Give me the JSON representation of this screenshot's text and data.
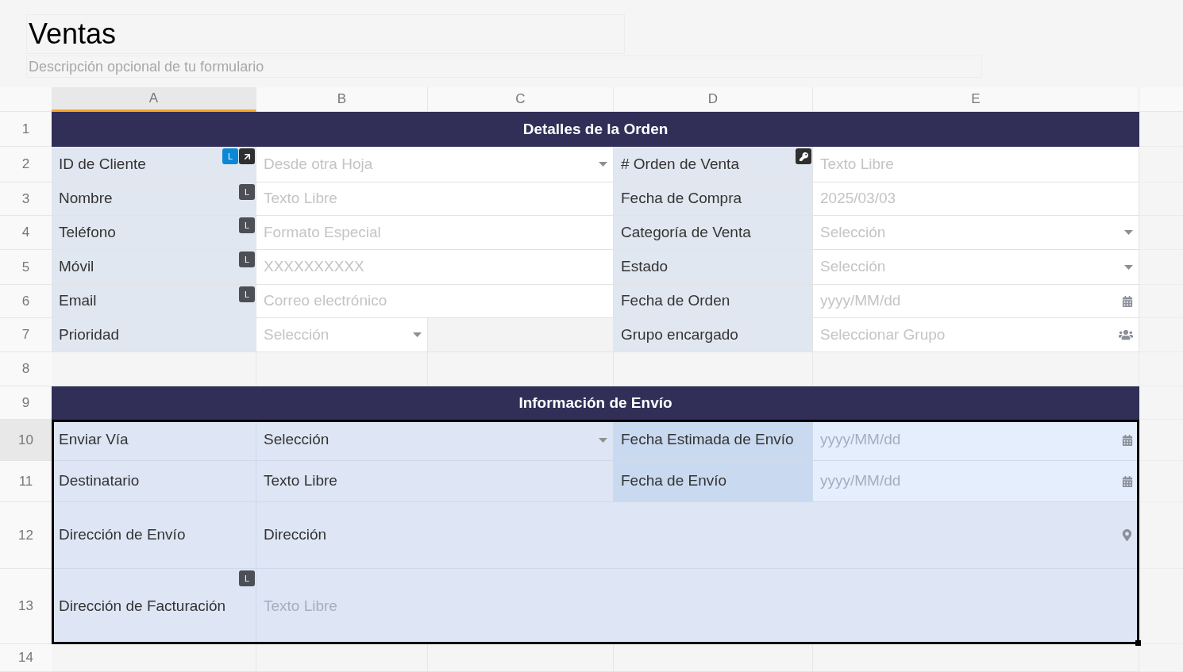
{
  "form": {
    "title": "Ventas",
    "description": "Descripción opcional de tu formulario"
  },
  "columns": [
    {
      "label": "A",
      "selected": true
    },
    {
      "label": "B",
      "selected": false
    },
    {
      "label": "C",
      "selected": false
    },
    {
      "label": "D",
      "selected": false
    },
    {
      "label": "E",
      "selected": false
    }
  ],
  "rows": [
    {
      "number": "1",
      "selected": false,
      "kind": "header",
      "title": "Detalles de la Orden"
    },
    {
      "number": "2",
      "selected": false,
      "kind": "pair",
      "cells": [
        {
          "kind": "label",
          "text": "ID de Cliente",
          "badges": [
            {
              "kind": "letter",
              "text": "L",
              "highlighted": true
            },
            {
              "kind": "link"
            }
          ]
        },
        {
          "kind": "dropdown",
          "placeholder": "Desde otra Hoja"
        },
        {
          "kind": "label",
          "text": "# Orden de Venta",
          "badges": [
            {
              "kind": "key"
            }
          ]
        },
        {
          "kind": "text",
          "placeholder": "Texto Libre"
        }
      ]
    },
    {
      "number": "3",
      "selected": false,
      "kind": "pair",
      "cells": [
        {
          "kind": "label",
          "text": "Nombre",
          "badges": [
            {
              "kind": "letter",
              "text": "L",
              "highlighted": false
            }
          ]
        },
        {
          "kind": "text",
          "placeholder": "Texto Libre"
        },
        {
          "kind": "label",
          "text": "Fecha de Compra"
        },
        {
          "kind": "text",
          "placeholder": "2025/03/03"
        }
      ]
    },
    {
      "number": "4",
      "selected": false,
      "kind": "pair",
      "cells": [
        {
          "kind": "label",
          "text": "Teléfono",
          "badges": [
            {
              "kind": "letter",
              "text": "L",
              "highlighted": false
            }
          ]
        },
        {
          "kind": "text",
          "placeholder": "Formato Especial"
        },
        {
          "kind": "label",
          "text": "Categoría de Venta"
        },
        {
          "kind": "dropdown",
          "placeholder": "Selección"
        }
      ]
    },
    {
      "number": "5",
      "selected": false,
      "kind": "pair",
      "cells": [
        {
          "kind": "label",
          "text": "Móvil",
          "badges": [
            {
              "kind": "letter",
              "text": "L",
              "highlighted": false
            }
          ]
        },
        {
          "kind": "text",
          "placeholder": "XXXXXXXXXX"
        },
        {
          "kind": "label",
          "text": "Estado"
        },
        {
          "kind": "dropdown",
          "placeholder": "Selección"
        }
      ]
    },
    {
      "number": "6",
      "selected": false,
      "kind": "pair",
      "cells": [
        {
          "kind": "label",
          "text": "Email",
          "badges": [
            {
              "kind": "letter",
              "text": "L",
              "highlighted": false
            }
          ]
        },
        {
          "kind": "text",
          "placeholder": "Correo electrónico"
        },
        {
          "kind": "label",
          "text": "Fecha de Orden"
        },
        {
          "kind": "date",
          "placeholder": "yyyy/MM/dd"
        }
      ]
    },
    {
      "number": "7",
      "selected": false,
      "kind": "pair_narrow",
      "cells": [
        {
          "kind": "label",
          "text": "Prioridad"
        },
        {
          "kind": "dropdown",
          "placeholder": "Selección"
        },
        {
          "kind": "empty"
        },
        {
          "kind": "label",
          "text": "Grupo encargado"
        },
        {
          "kind": "group",
          "placeholder": "Seleccionar Grupo"
        }
      ]
    },
    {
      "number": "8",
      "selected": false,
      "kind": "blank"
    },
    {
      "number": "9",
      "selected": false,
      "kind": "header",
      "title": "Información de Envío"
    },
    {
      "number": "10",
      "selected": true,
      "in_selection": true,
      "kind": "pair",
      "cells": [
        {
          "kind": "label",
          "text": "Enviar Vía"
        },
        {
          "kind": "dropdown",
          "value": "Selección"
        },
        {
          "kind": "label",
          "text": "Fecha Estimada de Envío"
        },
        {
          "kind": "date",
          "placeholder": "yyyy/MM/dd"
        }
      ]
    },
    {
      "number": "11",
      "selected": false,
      "in_selection": true,
      "kind": "pair",
      "cells": [
        {
          "kind": "label",
          "text": "Destinatario"
        },
        {
          "kind": "text",
          "value": "Texto Libre"
        },
        {
          "kind": "label",
          "text": "Fecha de Envío"
        },
        {
          "kind": "date",
          "placeholder": "yyyy/MM/dd"
        }
      ]
    },
    {
      "number": "12",
      "selected": false,
      "in_selection": true,
      "kind": "wide",
      "cells": [
        {
          "kind": "label",
          "text": "Dirección de Envío"
        },
        {
          "kind": "address",
          "value": "Dirección"
        }
      ]
    },
    {
      "number": "13",
      "selected": false,
      "in_selection": true,
      "kind": "wide",
      "cells": [
        {
          "kind": "label",
          "text": "Dirección de Facturación",
          "badges": [
            {
              "kind": "letter",
              "text": "L",
              "highlighted": false
            }
          ]
        },
        {
          "kind": "text",
          "placeholder": "Texto Libre"
        }
      ]
    },
    {
      "number": "14",
      "selected": false,
      "kind": "blank"
    }
  ]
}
